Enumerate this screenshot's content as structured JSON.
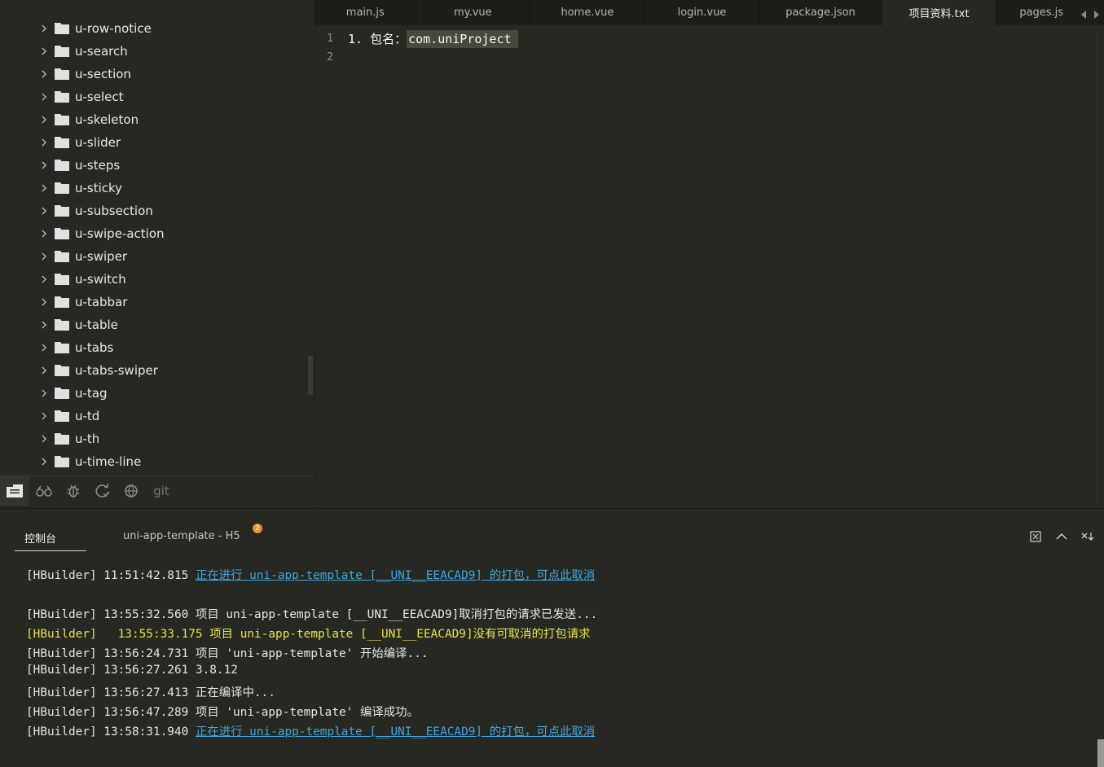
{
  "sidebar": {
    "items": [
      {
        "label": "u-row-notice"
      },
      {
        "label": "u-search"
      },
      {
        "label": "u-section"
      },
      {
        "label": "u-select"
      },
      {
        "label": "u-skeleton"
      },
      {
        "label": "u-slider"
      },
      {
        "label": "u-steps"
      },
      {
        "label": "u-sticky"
      },
      {
        "label": "u-subsection"
      },
      {
        "label": "u-swipe-action"
      },
      {
        "label": "u-swiper"
      },
      {
        "label": "u-switch"
      },
      {
        "label": "u-tabbar"
      },
      {
        "label": "u-table"
      },
      {
        "label": "u-tabs"
      },
      {
        "label": "u-tabs-swiper"
      },
      {
        "label": "u-tag"
      },
      {
        "label": "u-td"
      },
      {
        "label": "u-th"
      },
      {
        "label": "u-time-line"
      }
    ],
    "toolbar": {
      "icons": [
        "project-manager-icon",
        "binoculars-icon",
        "bug-icon",
        "refresh-debug-icon",
        "web-icon",
        "git-icon"
      ],
      "git_label": "git"
    }
  },
  "editor": {
    "tabs": [
      {
        "label": "main.js",
        "active": false
      },
      {
        "label": "my.vue",
        "active": false
      },
      {
        "label": "home.vue",
        "active": false
      },
      {
        "label": "login.vue",
        "active": false
      },
      {
        "label": "package.json",
        "active": false
      },
      {
        "label": "项目资料.txt",
        "active": true
      },
      {
        "label": "pages.js",
        "active": false
      }
    ],
    "lines": [
      {
        "number": "1",
        "prefix": "1. 包名：",
        "highlight": "com.uniProject"
      },
      {
        "number": "2",
        "prefix": "",
        "highlight": ""
      }
    ]
  },
  "console": {
    "tabs": [
      {
        "label": "控制台",
        "active": true
      },
      {
        "label": "uni-app-template - H5",
        "active": false
      }
    ],
    "badge": "2",
    "lines": [
      {
        "prefix": "[HBuilder] 11:51:42.815 ",
        "link": "正在进行 uni-app-template [__UNI__EEACAD9] 的打包，可点此取消",
        "type": "link"
      },
      {
        "prefix": "[HBuilder] 13:55:32.560 项目 uni-app-template [__UNI__EEACAD9]取消打包的请求已发送...",
        "link": "",
        "type": "normal"
      },
      {
        "prefix": "[HBuilder]   13:55:33.175 项目 uni-app-template [__UNI__EEACAD9]没有可取消的打包请求",
        "link": "",
        "type": "warn"
      },
      {
        "prefix": "[HBuilder] 13:56:24.731 项目 'uni-app-template' 开始编译...",
        "link": "",
        "type": "normal"
      },
      {
        "prefix": "[HBuilder] 13:56:27.261 3.8.12",
        "link": "",
        "type": "normal"
      },
      {
        "prefix": "[HBuilder] 13:56:27.413 正在编译中...",
        "link": "",
        "type": "normal"
      },
      {
        "prefix": "[HBuilder] 13:56:47.289 项目 'uni-app-template' 编译成功。",
        "link": "",
        "type": "normal"
      },
      {
        "prefix": "[HBuilder] 13:58:31.940 ",
        "link": "正在进行 uni-app-template [__UNI__EEACAD9] 的打包，可点此取消",
        "type": "link"
      }
    ]
  },
  "colors": {
    "background": "#272822",
    "tabbar": "#1d1e19",
    "link": "#3fa7e0",
    "warn": "#e8e34a",
    "badge": "#e8943a"
  }
}
